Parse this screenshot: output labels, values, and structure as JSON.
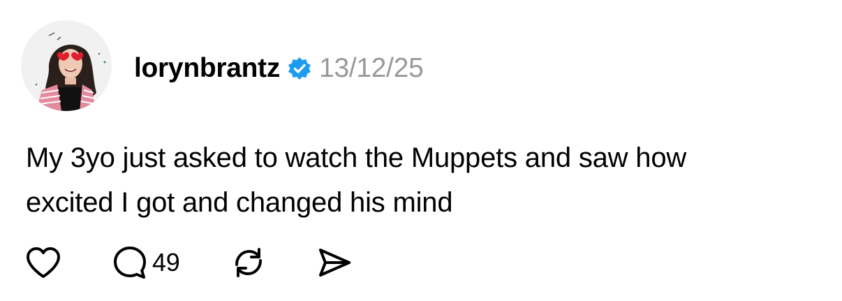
{
  "post": {
    "username": "lorynbrantz",
    "verified_icon": "verified-badge-icon",
    "timestamp": "13/12/25",
    "text_line1": "My 3yo just asked to watch the Muppets and saw how",
    "text_line2": "excited I got and changed his mind"
  },
  "actions": {
    "like_icon": "heart-icon",
    "reply_icon": "speech-bubble-icon",
    "reply_count": "49",
    "repost_icon": "repost-icon",
    "share_icon": "send-icon"
  },
  "colors": {
    "verified": "#1D9BF0",
    "timestamp": "#999999",
    "text": "#000000",
    "icons": "#000000"
  }
}
